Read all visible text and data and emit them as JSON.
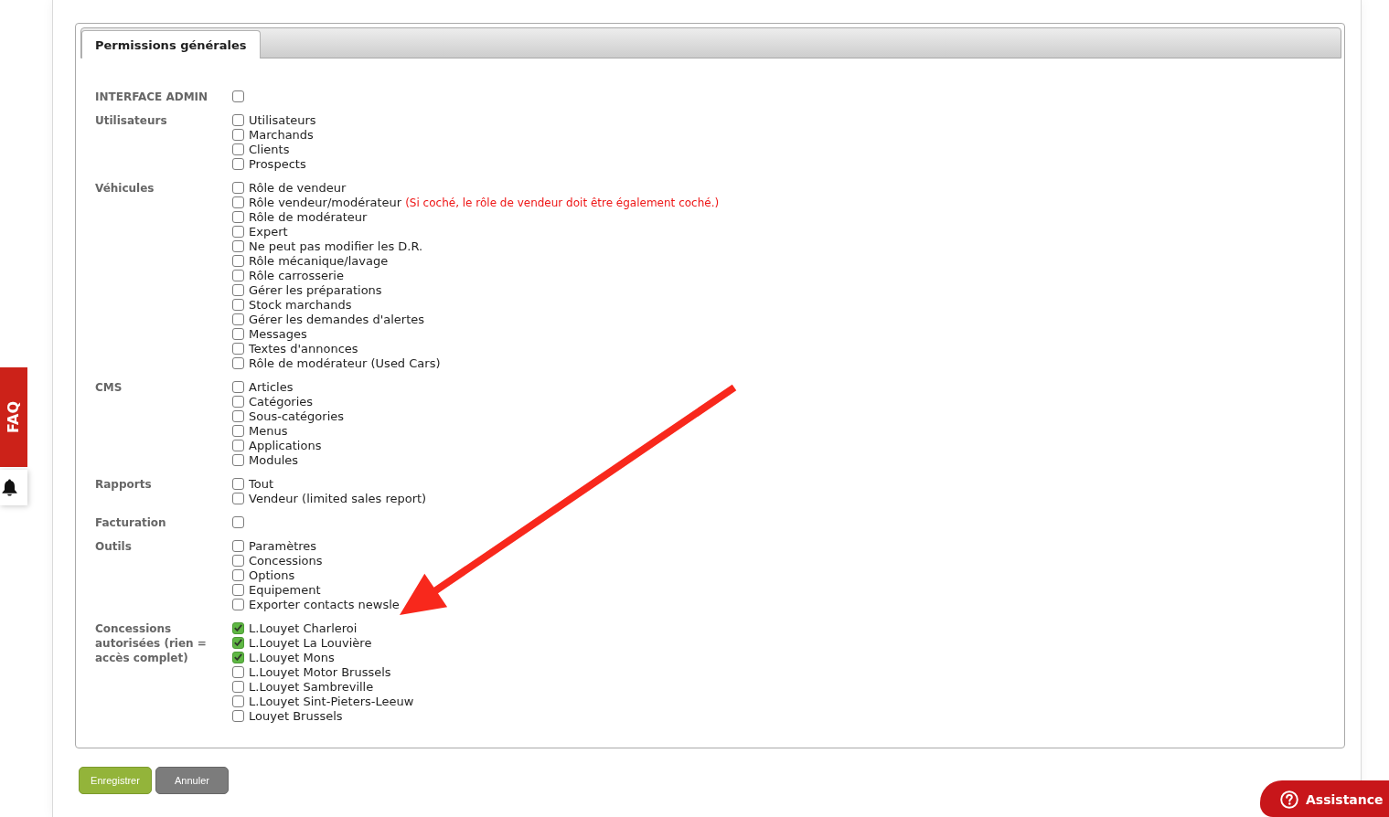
{
  "tabs": [
    {
      "label": "Permissions générales",
      "selected": true
    }
  ],
  "groups": [
    {
      "label": "INTERFACE ADMIN",
      "items": [
        {
          "checked": false
        }
      ]
    },
    {
      "label": "Utilisateurs",
      "items": [
        {
          "label": "Utilisateurs",
          "checked": false
        },
        {
          "label": "Marchands",
          "checked": false
        },
        {
          "label": "Clients",
          "checked": false
        },
        {
          "label": "Prospects",
          "checked": false
        }
      ]
    },
    {
      "label": "Véhicules",
      "items": [
        {
          "label": "Rôle de vendeur",
          "checked": false
        },
        {
          "label": "Rôle vendeur/modérateur",
          "checked": false,
          "note": "(Si coché, le rôle de vendeur doit être également coché.)"
        },
        {
          "label": "Rôle de modérateur",
          "checked": false
        },
        {
          "label": "Expert",
          "checked": false
        },
        {
          "label": "Ne peut pas modifier les D.R.",
          "checked": false
        },
        {
          "label": "Rôle mécanique/lavage",
          "checked": false
        },
        {
          "label": "Rôle carrosserie",
          "checked": false
        },
        {
          "label": "Gérer les préparations",
          "checked": false
        },
        {
          "label": "Stock marchands",
          "checked": false
        },
        {
          "label": "Gérer les demandes d'alertes",
          "checked": false
        },
        {
          "label": "Messages",
          "checked": false
        },
        {
          "label": "Textes d'annonces",
          "checked": false
        },
        {
          "label": "Rôle de modérateur (Used Cars)",
          "checked": false
        }
      ]
    },
    {
      "label": "CMS",
      "items": [
        {
          "label": "Articles",
          "checked": false
        },
        {
          "label": "Catégories",
          "checked": false
        },
        {
          "label": "Sous-catégories",
          "checked": false
        },
        {
          "label": "Menus",
          "checked": false
        },
        {
          "label": "Applications",
          "checked": false
        },
        {
          "label": "Modules",
          "checked": false
        }
      ]
    },
    {
      "label": "Rapports",
      "items": [
        {
          "label": "Tout",
          "checked": false
        },
        {
          "label": "Vendeur (limited sales report)",
          "checked": false
        }
      ]
    },
    {
      "label": "Facturation",
      "items": [
        {
          "checked": false
        }
      ]
    },
    {
      "label": "Outils",
      "items": [
        {
          "label": "Paramètres",
          "checked": false
        },
        {
          "label": "Concessions",
          "checked": false
        },
        {
          "label": "Options",
          "checked": false
        },
        {
          "label": "Equipement",
          "checked": false
        },
        {
          "label": "Exporter contacts newsle",
          "checked": false
        }
      ]
    },
    {
      "label": "Concessions autorisées (rien = accès complet)",
      "items": [
        {
          "label": "L.Louyet Charleroi",
          "checked": true
        },
        {
          "label": "L.Louyet La Louvière",
          "checked": true
        },
        {
          "label": "L.Louyet Mons",
          "checked": true
        },
        {
          "label": "L.Louyet Motor Brussels",
          "checked": false
        },
        {
          "label": "L.Louyet Sambreville",
          "checked": false
        },
        {
          "label": "L.Louyet Sint-Pieters-Leeuw",
          "checked": false
        },
        {
          "label": "Louyet Brussels",
          "checked": false
        }
      ]
    }
  ],
  "buttons": [
    {
      "label": "Enregistrer",
      "kind": "save"
    },
    {
      "label": "Annuler",
      "kind": "cancel"
    }
  ],
  "faq_tab": {
    "label": "FAQ"
  },
  "assistance_button": {
    "label": "Assistance"
  }
}
